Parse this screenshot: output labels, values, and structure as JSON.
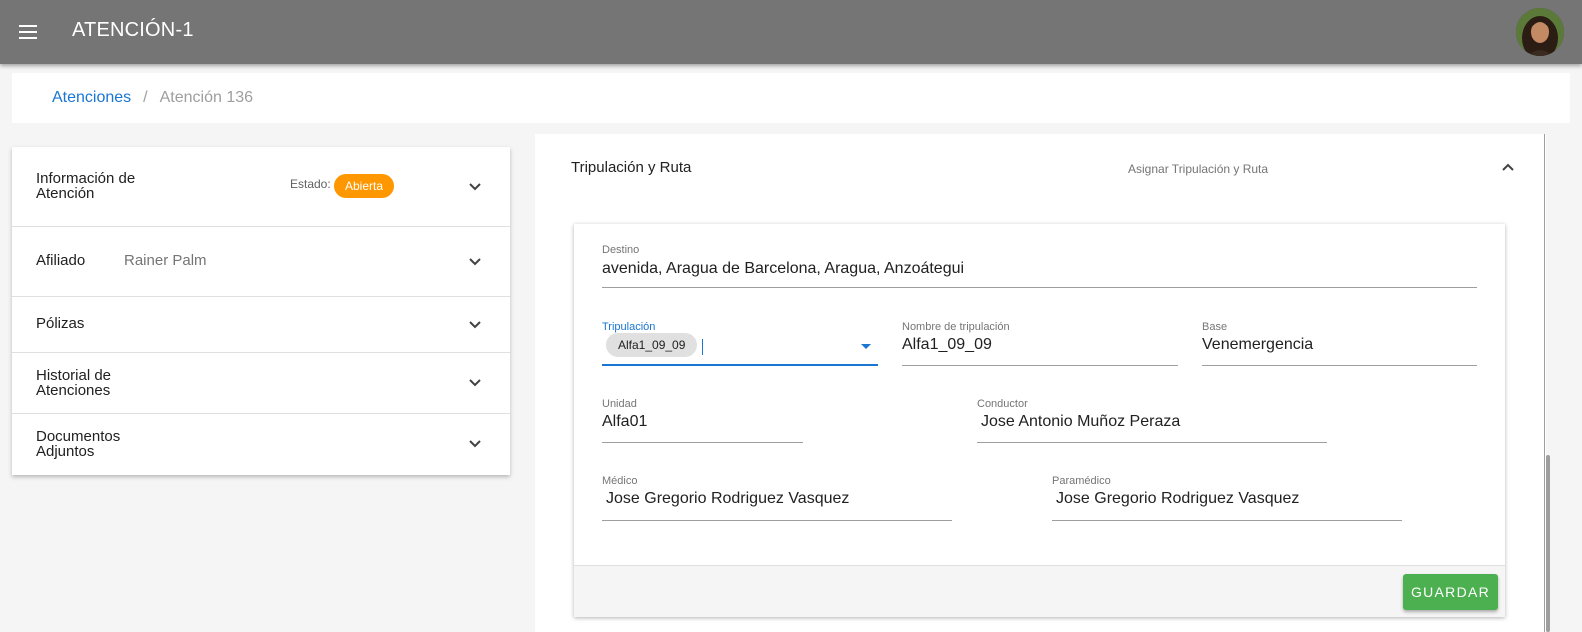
{
  "app": {
    "title": "ATENCIÓN-1"
  },
  "breadcrumb": {
    "parent": "Atenciones",
    "separator": "/",
    "current": "Atención 136"
  },
  "left_panel": {
    "items": [
      {
        "label": "Información de Atención",
        "label_lines": [
          "Información de",
          "Atención"
        ],
        "status_label": "Estado:",
        "status": "Abierta"
      },
      {
        "label": "Afiliado",
        "value": "Rainer Palm"
      },
      {
        "label": "Pólizas"
      },
      {
        "label": "Historial de Atenciones",
        "label_lines": [
          "Historial de",
          "Atenciones"
        ]
      },
      {
        "label": "Documentos Adjuntos",
        "label_lines": [
          "Documentos",
          "Adjuntos"
        ]
      }
    ]
  },
  "right_panel": {
    "title": "Tripulación y Ruta",
    "subtitle": "Asignar Tripulación y Ruta",
    "form": {
      "destino": {
        "label": "Destino",
        "value": "avenida, Aragua de Barcelona, Aragua, Anzoátegui"
      },
      "tripulacion": {
        "label": "Tripulación",
        "chip": "Alfa1_09_09"
      },
      "nombre_tripulacion": {
        "label": "Nombre de tripulación",
        "value": "Alfa1_09_09"
      },
      "base": {
        "label": "Base",
        "value": "Venemergencia"
      },
      "unidad": {
        "label": "Unidad",
        "value": "Alfa01"
      },
      "conductor": {
        "label": "Conductor",
        "value": "Jose Antonio Muñoz Peraza"
      },
      "medico": {
        "label": "Médico",
        "value": "Jose Gregorio Rodriguez Vasquez"
      },
      "paramedico": {
        "label": "Paramédico",
        "value": "Jose Gregorio Rodriguez Vasquez"
      }
    },
    "save_label": "GUARDAR"
  },
  "colors": {
    "appbar": "#757575",
    "link": "#1976d2",
    "status_badge": "#ff9800",
    "save_button": "#4caf50"
  },
  "icons": {
    "menu": "menu-icon",
    "expand": "chevron-down-icon",
    "collapse": "chevron-up-icon",
    "dropdown": "arrow-drop-down-icon"
  }
}
